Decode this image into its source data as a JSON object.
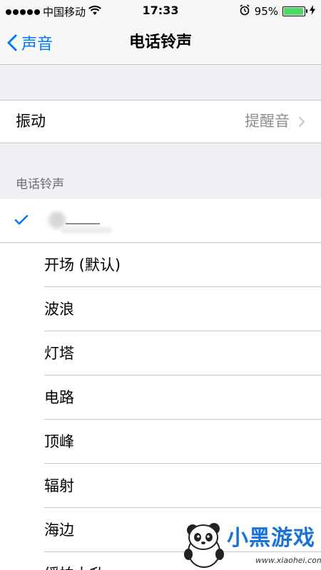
{
  "status_bar": {
    "carrier": "中国移动",
    "time": "17:33",
    "battery_percent": "95%",
    "battery_level": 0.95,
    "icons": [
      "signal-dots-icon",
      "wifi-icon",
      "alarm-icon",
      "battery-icon",
      "charging-bolt-icon"
    ]
  },
  "nav": {
    "back_label": "声音",
    "title": "电话铃声",
    "back_icon": "chevron-left-icon"
  },
  "vibration": {
    "label": "振动",
    "value": "提醒音"
  },
  "section": {
    "header": "电话铃声"
  },
  "ringtones": {
    "selected_index": 0,
    "items": [
      {
        "label": ""
      },
      {
        "label": "开场 (默认)"
      },
      {
        "label": "波浪"
      },
      {
        "label": "灯塔"
      },
      {
        "label": "电路"
      },
      {
        "label": "顶峰"
      },
      {
        "label": "辐射"
      },
      {
        "label": "海边"
      },
      {
        "label": "缓拍大升"
      }
    ]
  },
  "colors": {
    "accent": "#007aff",
    "battery_fill": "#4cd964",
    "background": "#efeff4",
    "separator": "#c8c7cc",
    "secondary_text": "#8e8e93"
  },
  "watermark": {
    "text": "小黑游戏",
    "url": "www.xiaohei.com"
  }
}
